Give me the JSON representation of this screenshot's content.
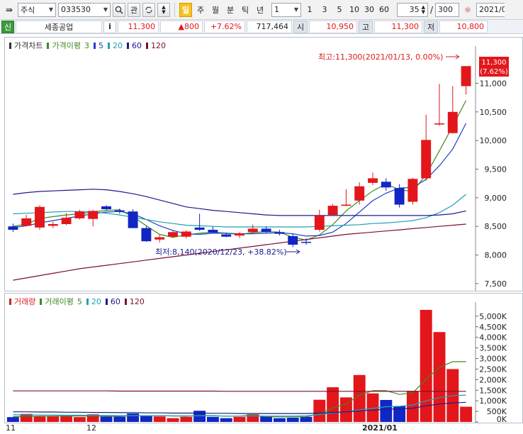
{
  "toolbar": {
    "market": "주식",
    "code": "033530",
    "watch": "관",
    "periods": [
      "일",
      "주",
      "월",
      "분",
      "틱",
      "년"
    ],
    "active_period": "일",
    "unit": "1",
    "intervals": [
      "1",
      "3",
      "5",
      "10",
      "30",
      "60"
    ],
    "count": "35",
    "total": "300",
    "date": "2021/0",
    "slash": "/"
  },
  "quote": {
    "flag": "신",
    "name": "세종공업",
    "info": "i",
    "price": "11,300",
    "change": "▲800",
    "rate": "+7.62%",
    "volume": "717,464",
    "open_label": "시",
    "open": "10,950",
    "high_label": "고",
    "high": "11,300",
    "low_label": "저",
    "low": "10,800"
  },
  "price_panel": {
    "legend": [
      {
        "label": "가격차트",
        "color": "#333333"
      },
      {
        "label": "가격이평",
        "color": "#3b8a1f"
      },
      {
        "label": "3",
        "color": "#3b8a1f"
      },
      {
        "label": "5",
        "color": "#1a43c9"
      },
      {
        "label": "20",
        "color": "#1fa1b5"
      },
      {
        "label": "60",
        "color": "#1a1a8c"
      },
      {
        "label": "120",
        "color": "#7a1030"
      }
    ],
    "high_note": "최고:11,300(2021/01/13, 0.00%)",
    "low_note": "최저:8,140(2020/12/23, +38.82%)",
    "current_price": "11,300",
    "current_rate": "(7.62%)"
  },
  "volume_panel": {
    "legend": [
      {
        "label": "거래량",
        "color": "#d62020"
      },
      {
        "label": "거래이평",
        "color": "#3b8a1f"
      },
      {
        "label": "5",
        "color": "#3b8a1f"
      },
      {
        "label": "20",
        "color": "#1fa1b5"
      },
      {
        "label": "60",
        "color": "#1a1a8c"
      },
      {
        "label": "120",
        "color": "#7a1030"
      }
    ]
  },
  "x_labels": [
    "11",
    "12",
    "2021/01"
  ],
  "chart_data": [
    {
      "type": "candlestick",
      "title": "가격차트",
      "ylim": [
        7400,
        11600
      ],
      "y_ticks": [
        7500,
        8000,
        8500,
        9000,
        9500,
        10000,
        10500,
        11000
      ],
      "y_tick_labels": [
        "7,500",
        "8,000",
        "8,500",
        "9,000",
        "9,500",
        "10,000",
        "10,500",
        "11,000"
      ],
      "candles": [
        {
          "o": 8500,
          "h": 8550,
          "l": 8400,
          "c": 8440
        },
        {
          "o": 8510,
          "h": 8700,
          "l": 8500,
          "c": 8640
        },
        {
          "o": 8480,
          "h": 8870,
          "l": 8440,
          "c": 8840
        },
        {
          "o": 8510,
          "h": 8580,
          "l": 8470,
          "c": 8540
        },
        {
          "o": 8540,
          "h": 8730,
          "l": 8520,
          "c": 8650
        },
        {
          "o": 8640,
          "h": 8790,
          "l": 8620,
          "c": 8760
        },
        {
          "o": 8630,
          "h": 8790,
          "l": 8500,
          "c": 8770
        },
        {
          "o": 8850,
          "h": 8870,
          "l": 8780,
          "c": 8800
        },
        {
          "o": 8780,
          "h": 8810,
          "l": 8720,
          "c": 8760
        },
        {
          "o": 8760,
          "h": 8800,
          "l": 8470,
          "c": 8470
        },
        {
          "o": 8470,
          "h": 8500,
          "l": 8230,
          "c": 8240
        },
        {
          "o": 8270,
          "h": 8350,
          "l": 8220,
          "c": 8310
        },
        {
          "o": 8320,
          "h": 8420,
          "l": 8300,
          "c": 8400
        },
        {
          "o": 8320,
          "h": 8430,
          "l": 8290,
          "c": 8410
        },
        {
          "o": 8480,
          "h": 8720,
          "l": 8420,
          "c": 8440
        },
        {
          "o": 8440,
          "h": 8500,
          "l": 8380,
          "c": 8390
        },
        {
          "o": 8360,
          "h": 8390,
          "l": 8310,
          "c": 8320
        },
        {
          "o": 8340,
          "h": 8400,
          "l": 8300,
          "c": 8380
        },
        {
          "o": 8400,
          "h": 8530,
          "l": 8370,
          "c": 8460
        },
        {
          "o": 8460,
          "h": 8500,
          "l": 8390,
          "c": 8400
        },
        {
          "o": 8400,
          "h": 8440,
          "l": 8340,
          "c": 8370
        },
        {
          "o": 8330,
          "h": 8380,
          "l": 8140,
          "c": 8180
        },
        {
          "o": 8230,
          "h": 8290,
          "l": 8180,
          "c": 8220
        },
        {
          "o": 8440,
          "h": 8790,
          "l": 8410,
          "c": 8690
        },
        {
          "o": 8700,
          "h": 8890,
          "l": 8690,
          "c": 8860
        },
        {
          "o": 8860,
          "h": 9150,
          "l": 8850,
          "c": 8880
        },
        {
          "o": 8950,
          "h": 9270,
          "l": 8880,
          "c": 9200
        },
        {
          "o": 9260,
          "h": 9440,
          "l": 9220,
          "c": 9340
        },
        {
          "o": 9280,
          "h": 9340,
          "l": 9120,
          "c": 9180
        },
        {
          "o": 9170,
          "h": 9240,
          "l": 8830,
          "c": 8880
        },
        {
          "o": 8930,
          "h": 9350,
          "l": 8880,
          "c": 9330
        },
        {
          "o": 9340,
          "h": 10450,
          "l": 9300,
          "c": 10010
        },
        {
          "o": 10280,
          "h": 10990,
          "l": 10260,
          "c": 10300
        },
        {
          "o": 10130,
          "h": 10950,
          "l": 10120,
          "c": 10500
        },
        {
          "o": 10950,
          "h": 11300,
          "l": 10800,
          "c": 11300
        }
      ],
      "ma": [
        {
          "name": "3",
          "color": "#3b8a1f",
          "values": [
            8500,
            8540,
            8640,
            8670,
            8700,
            8720,
            8750,
            8780,
            8790,
            8670,
            8510,
            8360,
            8310,
            8350,
            8380,
            8400,
            8380,
            8360,
            8390,
            8410,
            8400,
            8310,
            8260,
            8350,
            8530,
            8770,
            8950,
            9120,
            9240,
            9140,
            9110,
            9400,
            9820,
            10250,
            10700
          ]
        },
        {
          "name": "5",
          "color": "#1a43c9",
          "values": [
            8480,
            8510,
            8560,
            8600,
            8640,
            8680,
            8720,
            8750,
            8760,
            8720,
            8620,
            8510,
            8430,
            8370,
            8360,
            8380,
            8380,
            8370,
            8370,
            8380,
            8390,
            8370,
            8330,
            8340,
            8400,
            8550,
            8750,
            8950,
            9080,
            9170,
            9180,
            9320,
            9560,
            9850,
            10300
          ]
        },
        {
          "name": "20",
          "color": "#1fa1b5",
          "values": [
            8720,
            8730,
            8740,
            8750,
            8760,
            8760,
            8750,
            8730,
            8700,
            8660,
            8620,
            8580,
            8550,
            8520,
            8510,
            8500,
            8490,
            8490,
            8490,
            8490,
            8490,
            8490,
            8490,
            8500,
            8510,
            8520,
            8530,
            8550,
            8560,
            8580,
            8600,
            8650,
            8740,
            8870,
            9060
          ]
        },
        {
          "name": "60",
          "color": "#1a1a8c",
          "values": [
            9060,
            9090,
            9110,
            9120,
            9130,
            9140,
            9150,
            9140,
            9110,
            9070,
            9020,
            8960,
            8900,
            8840,
            8810,
            8780,
            8760,
            8740,
            8720,
            8700,
            8690,
            8690,
            8690,
            8690,
            8690,
            8690,
            8690,
            8690,
            8690,
            8690,
            8690,
            8690,
            8700,
            8720,
            8770
          ]
        },
        {
          "name": "120",
          "color": "#7a1030",
          "values": [
            7560,
            7600,
            7640,
            7680,
            7720,
            7760,
            7790,
            7820,
            7850,
            7880,
            7910,
            7940,
            7970,
            8000,
            8030,
            8060,
            8090,
            8120,
            8150,
            8180,
            8210,
            8240,
            8270,
            8300,
            8330,
            8360,
            8380,
            8400,
            8420,
            8440,
            8460,
            8480,
            8500,
            8520,
            8540
          ]
        }
      ]
    },
    {
      "type": "bar",
      "title": "거래량",
      "ylim": [
        0,
        5600000
      ],
      "y_ticks": [
        0,
        500000,
        1000000,
        1500000,
        2000000,
        2500000,
        3000000,
        3500000,
        4000000,
        4500000,
        5000000
      ],
      "y_tick_labels": [
        "0K",
        "500K",
        "1,000K",
        "1,500K",
        "2,000K",
        "2,500K",
        "3,000K",
        "3,500K",
        "4,000K",
        "4,500K",
        "5,000K"
      ],
      "values": [
        230000,
        380000,
        250000,
        260000,
        280000,
        230000,
        360000,
        250000,
        250000,
        400000,
        280000,
        260000,
        180000,
        240000,
        530000,
        240000,
        180000,
        240000,
        360000,
        250000,
        180000,
        200000,
        240000,
        1050000,
        1640000,
        1160000,
        2220000,
        1350000,
        1040000,
        750000,
        1470000,
        5300000,
        4250000,
        2500000,
        720000
      ],
      "ma": [
        {
          "name": "5",
          "color": "#3b8a1f",
          "values": [
            250000,
            260000,
            270000,
            280000,
            280000,
            280000,
            280000,
            270000,
            270000,
            300000,
            300000,
            300000,
            280000,
            270000,
            300000,
            300000,
            270000,
            280000,
            320000,
            250000,
            240000,
            240000,
            240000,
            390000,
            660000,
            850000,
            1260000,
            1480000,
            1480000,
            1300000,
            1370000,
            2020000,
            2580000,
            2850000,
            2850000
          ]
        },
        {
          "name": "20",
          "color": "#1fa1b5",
          "values": [
            340000,
            340000,
            330000,
            330000,
            320000,
            320000,
            310000,
            310000,
            300000,
            300000,
            300000,
            300000,
            290000,
            290000,
            290000,
            290000,
            280000,
            280000,
            280000,
            280000,
            280000,
            280000,
            290000,
            350000,
            420000,
            480000,
            570000,
            640000,
            720000,
            740000,
            800000,
            1000000,
            1150000,
            1240000,
            1270000
          ]
        },
        {
          "name": "60",
          "color": "#1a1a8c",
          "values": [
            480000,
            480000,
            470000,
            470000,
            460000,
            460000,
            450000,
            450000,
            440000,
            440000,
            430000,
            430000,
            420000,
            420000,
            420000,
            410000,
            410000,
            400000,
            400000,
            400000,
            400000,
            400000,
            400000,
            420000,
            450000,
            480000,
            520000,
            560000,
            600000,
            620000,
            650000,
            760000,
            850000,
            900000,
            930000
          ]
        },
        {
          "name": "120",
          "color": "#7a1030",
          "values": [
            1470000,
            1470000,
            1470000,
            1470000,
            1470000,
            1470000,
            1470000,
            1470000,
            1460000,
            1460000,
            1460000,
            1460000,
            1460000,
            1460000,
            1460000,
            1460000,
            1450000,
            1450000,
            1450000,
            1450000,
            1450000,
            1450000,
            1450000,
            1450000,
            1450000,
            1450000,
            1450000,
            1450000,
            1450000,
            1450000,
            1450000,
            1450000,
            1450000,
            1450000,
            1450000
          ]
        }
      ]
    }
  ]
}
